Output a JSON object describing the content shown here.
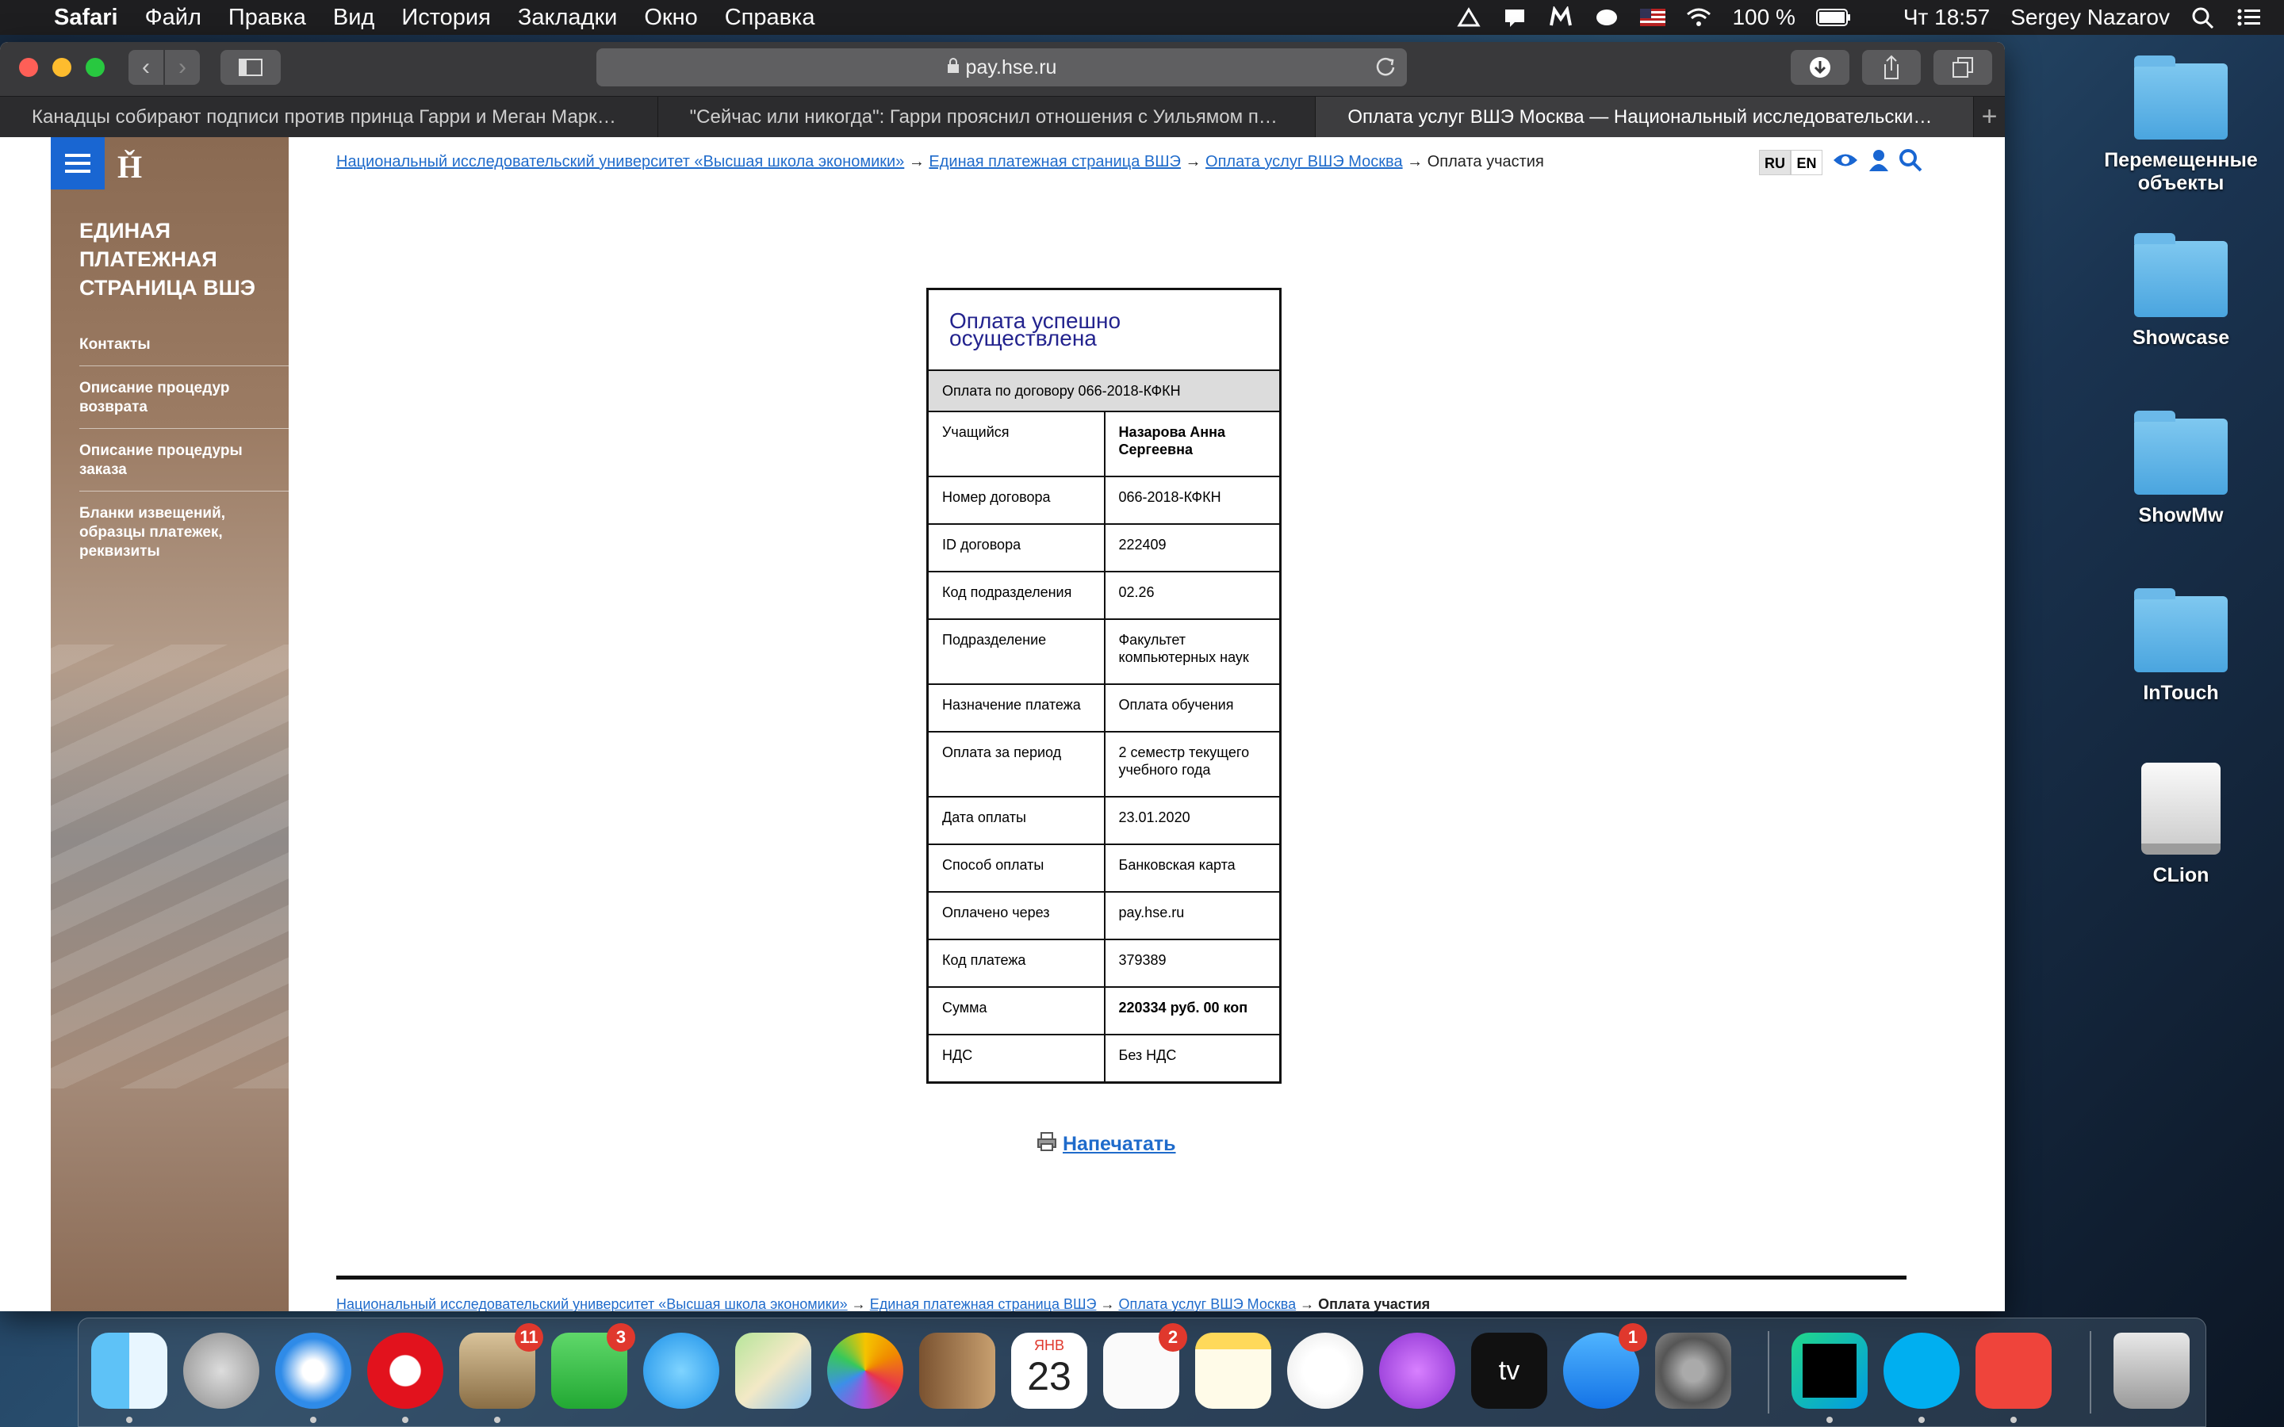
{
  "menubar": {
    "app": "Safari",
    "items": [
      "Файл",
      "Правка",
      "Вид",
      "История",
      "Закладки",
      "Окно",
      "Справка"
    ],
    "battery": "100 %",
    "clock": "Чт 18:57",
    "user": "Sergey Nazarov"
  },
  "browser": {
    "url": "pay.hse.ru",
    "tabs": [
      "Канадцы собирают подписи против принца Гарри и Меган Маркл :: Нов...",
      "\"Сейчас или никогда\": Гарри прояснил отношения с Уильямом перед...",
      "Оплата услуг ВШЭ Москва — Национальный исследовательский у..."
    ],
    "new_tab": "+"
  },
  "sidebar": {
    "logo": "Ȟ",
    "title": "Единая платежная страница ВШЭ",
    "items": [
      "Контакты",
      "Описание процедур возврата",
      "Описание процедуры заказа",
      "Бланки извещений, образцы платежек, реквизиты"
    ]
  },
  "breadcrumb": {
    "l1": "Национальный исследовательский университет «Высшая школа экономики»",
    "l2": "Единая платежная страница ВШЭ",
    "l3": "Оплата услуг ВШЭ Москва",
    "current": "Оплата участия",
    "sep": " → "
  },
  "lang": {
    "ru": "RU",
    "en": "EN"
  },
  "receipt": {
    "title": "Оплата успешно осуществлена",
    "subtitle": "Оплата по договору 066-2018-КФКН",
    "rows": [
      {
        "label": "Учащийся",
        "value": "Назарова Анна Сергеевна"
      },
      {
        "label": "Номер договора",
        "value": "066-2018-КФКН"
      },
      {
        "label": "ID договора",
        "value": "222409"
      },
      {
        "label": "Код подразделения",
        "value": "02.26"
      },
      {
        "label": "Подразделение",
        "value": "Факультет компьютерных наук"
      },
      {
        "label": "Назначение платежа",
        "value": "Оплата обучения"
      },
      {
        "label": "Оплата за период",
        "value": "2 семестр текущего учебного года"
      },
      {
        "label": "Дата оплаты",
        "value": "23.01.2020"
      },
      {
        "label": "Способ оплаты",
        "value": "Банковская карта"
      },
      {
        "label": "Оплачено через",
        "value": "pay.hse.ru"
      },
      {
        "label": "Код платежа",
        "value": "379389"
      },
      {
        "label": "Сумма",
        "value": "220334 руб. 00 коп"
      },
      {
        "label": "НДС",
        "value": "Без НДС"
      }
    ]
  },
  "print_label": "Напечатать",
  "desktop": [
    "Перемещенные объекты",
    "Showcase",
    "ShowMw",
    "InTouch",
    "CLion"
  ],
  "dock": {
    "badges": {
      "mail": "11",
      "facetime": "3",
      "reminders": "2",
      "appstore": "1"
    },
    "calendar_month": "ЯНВ",
    "calendar_day": "23",
    "tv": "tv"
  }
}
